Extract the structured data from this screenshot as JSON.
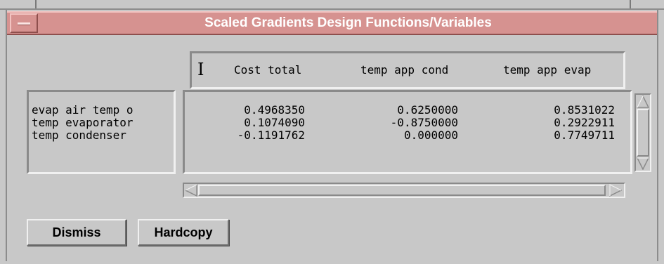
{
  "window": {
    "title": "Scaled Gradients Design Functions/Variables"
  },
  "columns": [
    "Cost total",
    "temp app cond",
    "temp app evap"
  ],
  "rows": [
    {
      "label": "evap air temp o",
      "values": [
        "0.4968350",
        "0.6250000",
        "0.8531022"
      ]
    },
    {
      "label": "temp evaporator",
      "values": [
        "0.1074090",
        "-0.8750000",
        "0.2922911"
      ]
    },
    {
      "label": "temp condenser",
      "values": [
        "-0.1191762",
        "0.000000",
        "0.7749711"
      ]
    }
  ],
  "buttons": {
    "dismiss": "Dismiss",
    "hardcopy": "Hardcopy"
  },
  "colors": {
    "titlebar": "#d69290",
    "background": "#c8c8c8"
  }
}
